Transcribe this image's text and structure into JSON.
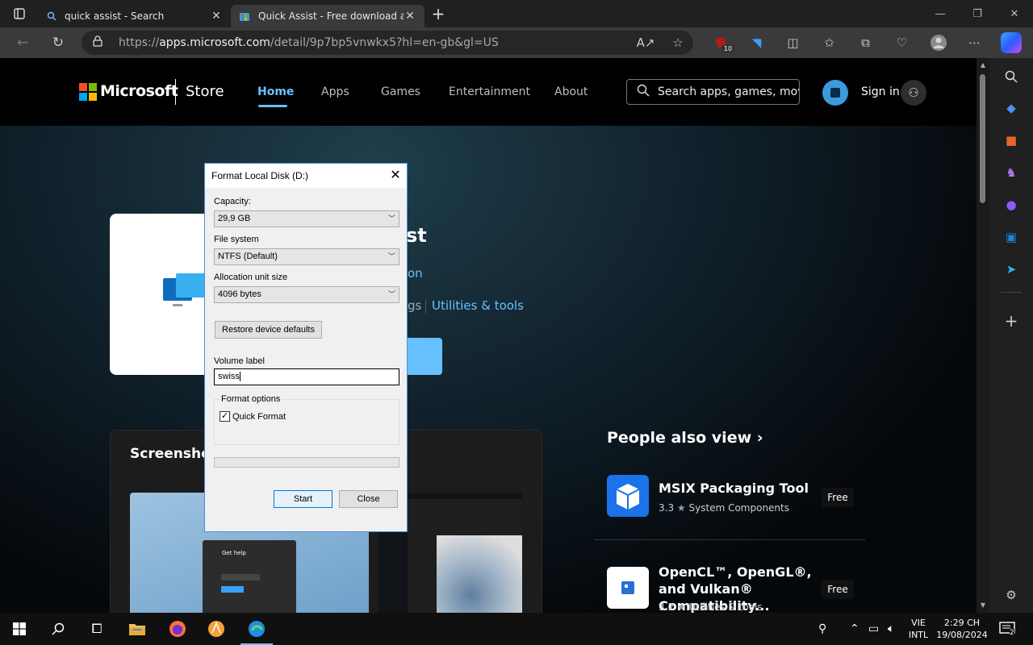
{
  "browser": {
    "tabs": [
      {
        "title": "quick assist - Search",
        "icon": "search-icon"
      },
      {
        "title": "Quick Assist - Free download and install on Windows | Microsoft Store",
        "icon": "store-icon",
        "active": true
      }
    ],
    "url_prefix": "https://",
    "url_domain": "apps.microsoft.com",
    "url_path": "/detail/9p7bp5vnwkx5?hl=en-gb&gl=US",
    "extension_badge": "10"
  },
  "store": {
    "brand": "Microsoft",
    "store_label": "Store",
    "nav": [
      "Home",
      "Apps",
      "Games",
      "Entertainment",
      "About"
    ],
    "search_placeholder": "Search apps, games, movi",
    "sign_in": "Sign in",
    "app_title_fragment": "st",
    "app_publisher_fragment": "on",
    "app_category_fragment": "gs",
    "app_category_link": "Utilities & tools",
    "screenshots_title": "Screenshots",
    "screenshot_dialog_title": "Get help",
    "people_also_view": "People also view",
    "related": [
      {
        "name": "MSIX Packaging Tool",
        "rating": "3.3",
        "category": "System Components",
        "price": "Free",
        "color": "#1a73e8"
      },
      {
        "name": "OpenCL™, OpenGL®, and Vulkan® Compatibility...",
        "rating": "3.2",
        "category": "Utilities & tools",
        "price": "Free",
        "color": "#ffffff"
      }
    ]
  },
  "dialog": {
    "title": "Format Local Disk (D:)",
    "capacity_label": "Capacity:",
    "capacity_value": "29,9 GB",
    "filesystem_label": "File system",
    "filesystem_value": "NTFS (Default)",
    "allocation_label": "Allocation unit size",
    "allocation_value": "4096 bytes",
    "restore_button": "Restore device defaults",
    "volume_label": "Volume label",
    "volume_value": "swiss",
    "format_options_label": "Format options",
    "quick_format_label": "Quick Format",
    "quick_format_checked": "✓",
    "start_button": "Start",
    "close_button": "Close"
  },
  "taskbar": {
    "language_top": "VIE",
    "language_bottom": "INTL",
    "time": "2:29 CH",
    "date": "19/08/2024",
    "notification_count": "2"
  }
}
